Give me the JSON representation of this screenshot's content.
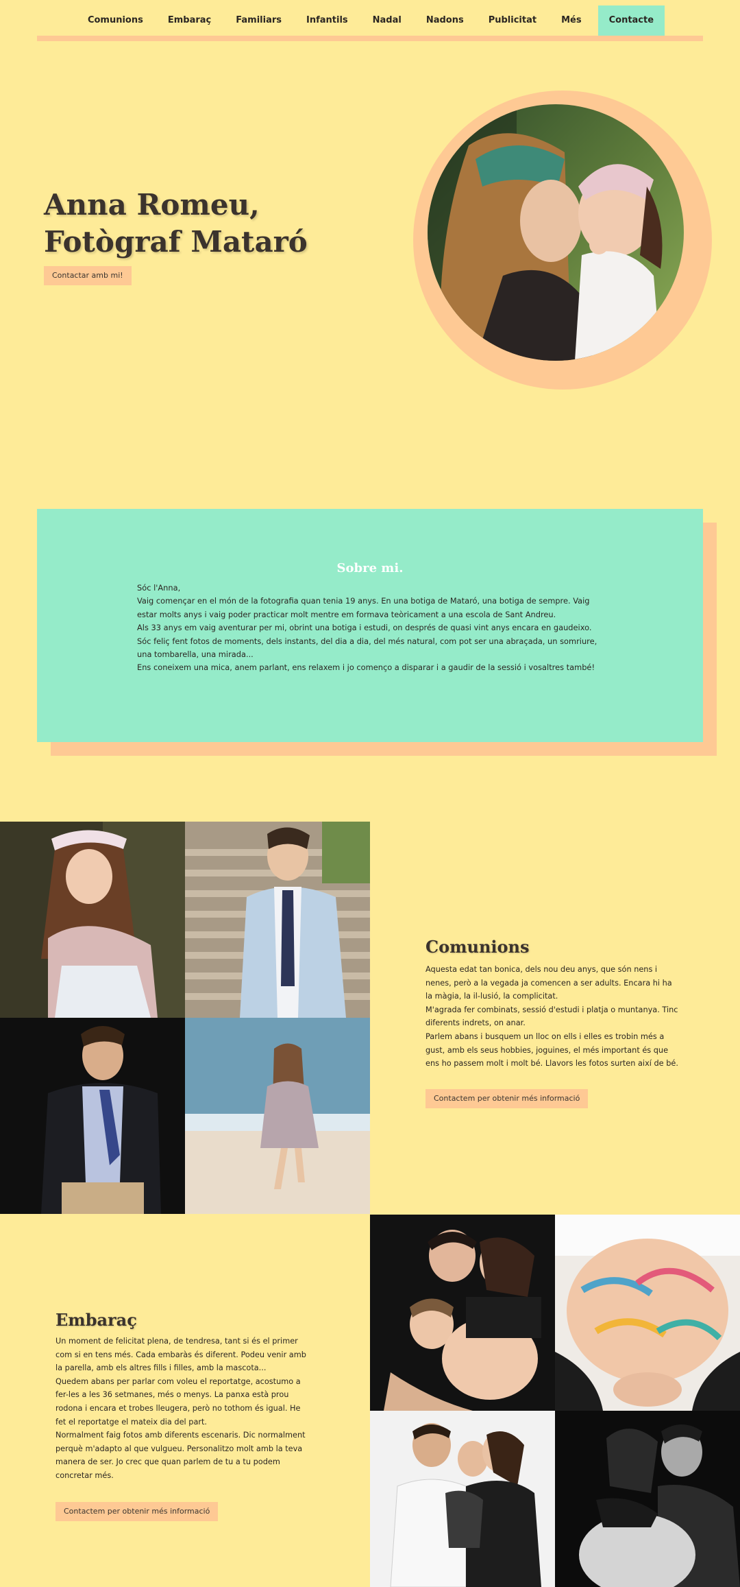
{
  "nav": {
    "items": [
      "Comunions",
      "Embaraç",
      "Familiars",
      "Infantils",
      "Nadal",
      "Nadons",
      "Publicitat",
      "Més"
    ],
    "active": "Contacte"
  },
  "hero": {
    "title_line1": "Anna Romeu,",
    "title_line2": "Fotògraf Mataró",
    "button": "Contactar amb mi!"
  },
  "about": {
    "title": "Sobre mi.",
    "paragraphs": [
      "Sóc l'Anna,",
      "Vaig començar en el món de la fotografia quan tenia 19 anys. En una botiga de Mataró, una botiga de sempre. Vaig estar molts anys i vaig poder practicar molt mentre em formava teòricament a una escola de Sant Andreu.",
      "Als 33 anys em vaig aventurar per mi, obrint una botiga i estudi, on després de quasi vint anys encara en gaudeixo.",
      "Sóc feliç fent fotos de moments, dels instants, del dia a dia, del més natural, com pot ser una abraçada, un somriure, una tombarella, una mirada...",
      "Ens coneixem una mica, anem parlant, ens relaxem i jo començo a disparar i a gaudir de la sessió i vosaltres també!"
    ]
  },
  "comunions": {
    "title": "Comunions",
    "paragraphs": [
      "Aquesta edat tan bonica, dels nou deu anys, que són nens i nenes, però a la vegada ja comencen a ser adults. Encara hi ha la màgia, la il-lusió, la complicitat.",
      "M'agrada fer combinats, sessió d'estudi i platja o muntanya. Tinc diferents indrets, on anar.",
      "Parlem abans i busquem un lloc on ells i elles es trobin més a gust, amb els seus hobbies, joguines, el més important és que ens ho passem molt i molt bé. Llavors les fotos surten així de bé."
    ],
    "button": "Contactem per obtenir més informació"
  },
  "embaras": {
    "title": "Embaraç",
    "paragraphs": [
      "Un moment de felicitat plena, de tendresa, tant si és el primer com si en tens més. Cada embaràs és diferent. Podeu venir amb la parella, amb els altres fills i filles, amb la mascota...",
      "Quedem abans per parlar com voleu el reportatge, acostumo a fer-les a les 36 setmanes, més o menys. La panxa està prou rodona i encara et trobes lleugera, però no tothom és igual. He fet el reportatge el mateix dia del part.",
      "Normalment faig fotos amb diferents escenaris. Dic normalment perquè m'adapto al que vulgueu. Personalitzo molt amb la teva manera de ser. Jo crec que quan parlem de tu a tu podem concretar més."
    ],
    "button": "Contactem per obtenir més informació"
  },
  "colors": {
    "background": "#feeb98",
    "accent_mint": "#95ebc9",
    "accent_peach": "#fec994"
  }
}
